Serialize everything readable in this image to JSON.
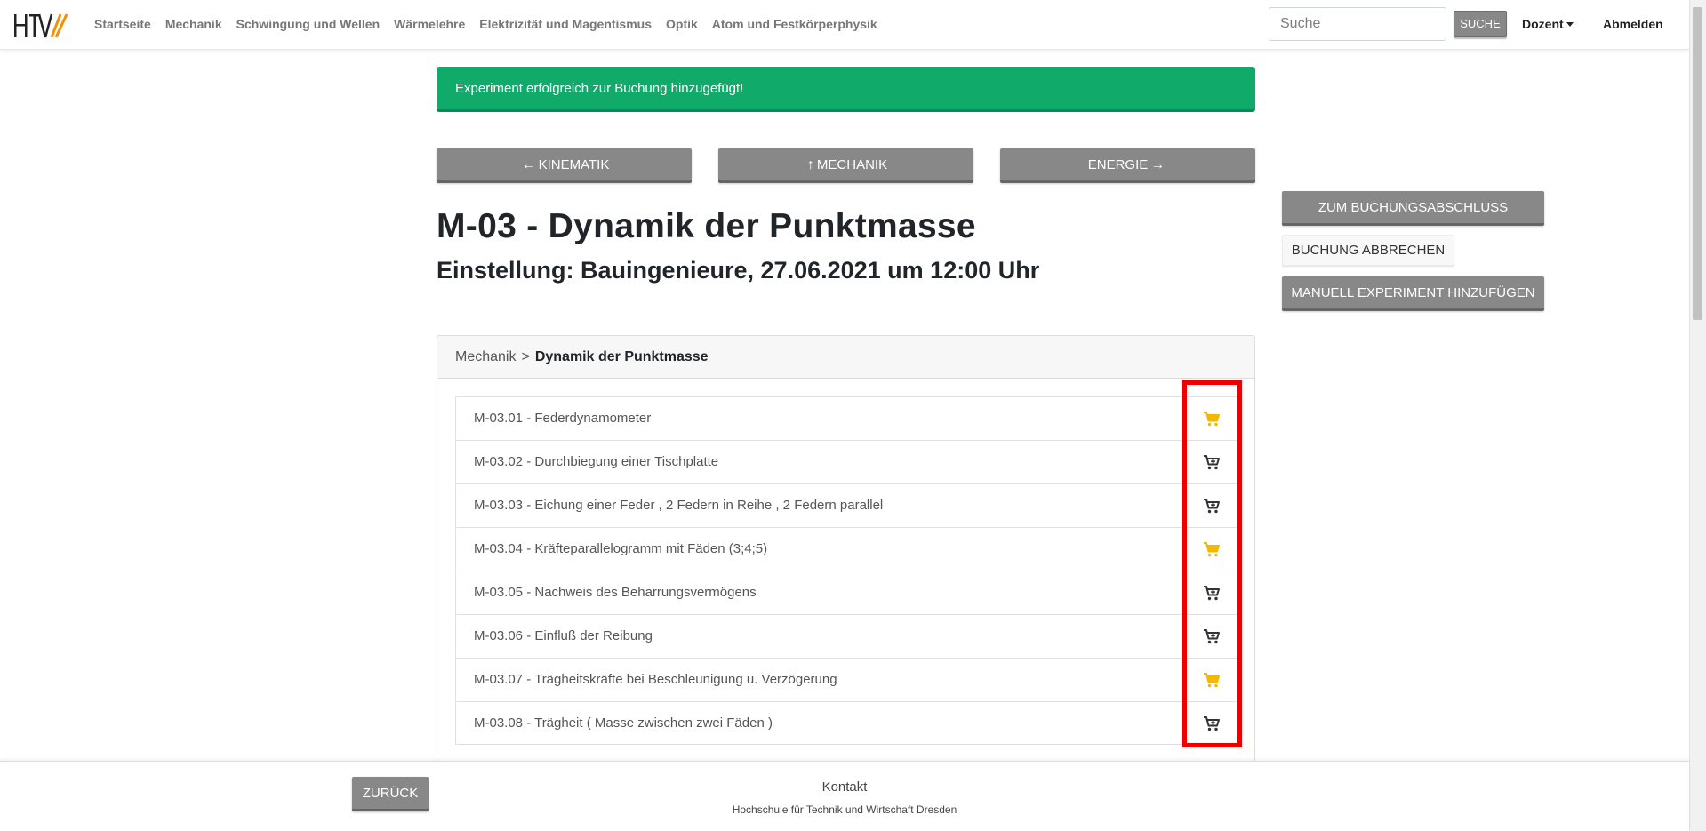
{
  "navbar": {
    "links": [
      "Startseite",
      "Mechanik",
      "Schwingung und Wellen",
      "Wärmelehre",
      "Elektrizität und Magentismus",
      "Optik",
      "Atom und Festkörperphysik"
    ],
    "search_placeholder": "Suche",
    "search_button": "SUCHE",
    "user_menu": "Dozent",
    "logout": "Abmelden"
  },
  "alert": {
    "message": "Experiment erfolgreich zur Buchung hinzugefügt!",
    "color": "#10ab6a"
  },
  "page_nav": {
    "prev": "KINEMATIK",
    "up": "MECHANIK",
    "next": "ENERGIE"
  },
  "title": "M-03 - Dynamik der Punktmasse",
  "subtitle": "Einstellung: Bauingenieure, 27.06.2021 um 12:00 Uhr",
  "side_actions": {
    "complete": "ZUM BUCHUNGSABSCHLUSS",
    "cancel": "BUCHUNG ABBRECHEN",
    "manual_add": "MANUELL EXPERIMENT HINZUFÜGEN"
  },
  "breadcrumb": {
    "parent": "Mechanik",
    "separator": ">",
    "current": "Dynamik der Punktmasse"
  },
  "experiments": [
    {
      "label": "M-03.01 - Federdynamometer",
      "cart_icon": "cart-in-booking-icon",
      "in_booking": true
    },
    {
      "label": "M-03.02 - Durchbiegung einer Tischplatte",
      "cart_icon": "add-to-cart-icon",
      "in_booking": false
    },
    {
      "label": "M-03.03 - Eichung einer Feder , 2 Federn in Reihe , 2 Federn parallel",
      "cart_icon": "add-to-cart-icon",
      "in_booking": false
    },
    {
      "label": "M-03.04 - Kräfteparallelogramm mit Fäden (3;4;5)",
      "cart_icon": "cart-in-booking-icon",
      "in_booking": true
    },
    {
      "label": "M-03.05 - Nachweis des Beharrungsvermögens",
      "cart_icon": "add-to-cart-icon",
      "in_booking": false
    },
    {
      "label": "M-03.06 - Einfluß der Reibung",
      "cart_icon": "add-to-cart-icon",
      "in_booking": false
    },
    {
      "label": "M-03.07 - Trägheitskräfte bei Beschleunigung u. Verzögerung",
      "cart_icon": "cart-in-booking-icon",
      "in_booking": true
    },
    {
      "label": "M-03.08 - Trägheit ( Masse zwischen zwei Fäden )",
      "cart_icon": "add-to-cart-icon",
      "in_booking": false
    }
  ],
  "colors": {
    "cart_in_booking": "#f5b800",
    "cart_default": "#333333",
    "highlight_box": "#ee0000",
    "button_gray": "#888888"
  },
  "footer": {
    "back": "ZURÜCK",
    "contact": "Kontakt",
    "institution": "Hochschule für Technik und Wirtschaft Dresden"
  }
}
